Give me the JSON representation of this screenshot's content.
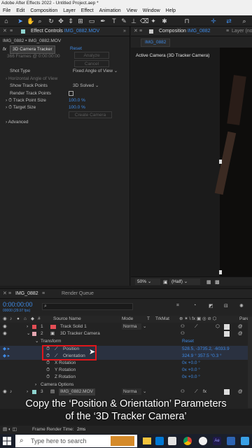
{
  "title_bar": {
    "title": "Adobe After Effects 2022 - Untitled Project.aep *"
  },
  "menu": [
    "File",
    "Edit",
    "Composition",
    "Layer",
    "Effect",
    "Animation",
    "View",
    "Window",
    "Help"
  ],
  "toolbar": {
    "icons": [
      "arrow-icon",
      "hand-icon",
      "zoom-icon",
      "camera-orbit-icon",
      "camera-pan-icon",
      "camera-dolly-icon",
      "pan-behind-icon",
      "rectangle-icon",
      "pen-icon",
      "type-icon",
      "brush-icon",
      "clone-icon",
      "eraser-icon",
      "roto-icon",
      "puppet-icon"
    ]
  },
  "effect_controls": {
    "tab_label": "Effect Controls",
    "tab_layer": "IMG_0882.MOV",
    "breadcrumb": "IMG_0882 • IMG_0882.MOV",
    "effect_name": "3D Camera Tracker",
    "reset": "Reset",
    "analyze_label": "Analyze",
    "cancel_label": "Cancel",
    "status": "366 Frames @ 0:00:00:00",
    "properties": [
      {
        "name": "Shot Type",
        "value": "Fixed Angle of View"
      },
      {
        "name": "Horizontal Angle of View",
        "value": ""
      },
      {
        "name": "Show Track Points",
        "value": "3D Solved"
      },
      {
        "name": "Render Track Points",
        "value": ""
      },
      {
        "name": "Track Point Size",
        "value": "100.0 %"
      },
      {
        "name": "Target Size",
        "value": "100.0 %"
      }
    ],
    "create_camera": "Create Camera",
    "advanced": "Advanced"
  },
  "composition": {
    "tab_label": "Composition",
    "tab_name": "IMG_0882",
    "layer_tab": "Layer (no",
    "subtab": "IMG_0882",
    "viewer_label": "Active Camera (3D Tracker Camera)",
    "zoom": "50%",
    "resolution": "(Half)"
  },
  "timeline": {
    "tab_name": "IMG_0882",
    "render_queue": "Render Queue",
    "timecode": "0:00:00:00",
    "timecode_sub": "00000 (29.97 fps)",
    "search_placeholder": "",
    "columns": [
      "Source Name",
      "Mode",
      "T",
      "TrkMat",
      "Parent"
    ],
    "layers": [
      {
        "num": "1",
        "name": "Track Solid 1",
        "mode": "Norma"
      },
      {
        "num": "2",
        "name": "3D Tracker Camera",
        "mode": ""
      },
      {
        "num": "3",
        "name": "IMG_0882.MOV",
        "mode": "Norma"
      }
    ],
    "transform": {
      "label": "Transform",
      "reset": "Reset"
    },
    "properties": [
      {
        "name": "Position",
        "value": "528.5, -3735.2, -6033.9"
      },
      {
        "name": "Orientation",
        "value": "324.9 ° 357.5 °0.3 °"
      },
      {
        "name": "X Rotation",
        "value": "0x +0.0 °"
      },
      {
        "name": "Y Rotation",
        "value": "0x +0.0 °"
      },
      {
        "name": "Z Rotation",
        "value": "0x +0.0 °"
      }
    ],
    "camera_options": "Camera Options",
    "frame_render_label": "Frame Render Time:",
    "frame_render_value": "2ms"
  },
  "caption": {
    "line1": "Copy the ‘Position & Orientation’ Parameters",
    "line2": "of the ‘3D Tracker Camera’"
  },
  "taskbar": {
    "search_placeholder": "Type here to search"
  },
  "colors": {
    "accent_blue": "#3f8be6",
    "highlight_red": "#e0161b",
    "panel": "#232323"
  }
}
